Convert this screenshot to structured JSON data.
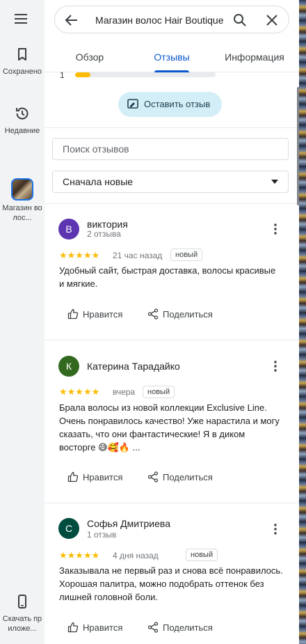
{
  "rail": {
    "items": [
      {
        "label": "Сохранено",
        "icon": "bookmark-icon"
      },
      {
        "label": "Недавние",
        "icon": "history-icon"
      },
      {
        "label": "Магазин волос...",
        "icon": "place-thumbnail"
      },
      {
        "label": "Скачать приложе...",
        "icon": "phone-icon"
      }
    ]
  },
  "search": {
    "value": "Магазин волос Hair Boutique"
  },
  "tabs": [
    {
      "label": "Обзор",
      "active": false
    },
    {
      "label": "Отзывы",
      "active": true
    },
    {
      "label": "Информация",
      "active": false
    }
  ],
  "rating_breakdown_partial": {
    "star_label": "1",
    "share": 0.11
  },
  "write_review_label": "Оставить отзыв",
  "review_search": {
    "placeholder": "Поиск отзывов"
  },
  "sort": {
    "selected": "Сначала новые"
  },
  "reviews": [
    {
      "initial": "В",
      "avatar_color": "#5e35b1",
      "author": "виктория",
      "meta": "2 отзыва",
      "rating": 5,
      "stars": "★★★★★",
      "date": "21 час назад",
      "badge": "новый",
      "text": "Удобный сайт, быстрая доставка, волосы красивые и мягкие.",
      "like": "Нравится",
      "share": "Поделиться"
    },
    {
      "initial": "К",
      "avatar_color": "#33691e",
      "author": "Катерина Тарадайко",
      "meta": "",
      "rating": 5,
      "stars": "★★★★★",
      "date": "вчера",
      "badge": "новый",
      "text": "Брала волосы из новой коллекции Exclusive Line. Очень понравилось качество! Уже нарастила и могу сказать, что они фантастические! Я в диком восторге 😅🥰🔥 ...",
      "like": "Нравится",
      "share": "Поделиться"
    },
    {
      "initial": "С",
      "avatar_color": "#004d40",
      "author": "Софья Дмитриева",
      "meta": "1 отзыв",
      "rating": 5,
      "stars": "★★★★★",
      "date": "4 дня назад",
      "badge": "новый",
      "text": "Заказывала не первый раз и снова всё понравилось. Хорошая палитра, можно подобрать оттенок без лишней головной боли.",
      "like": "Нравится",
      "share": "Поделиться"
    }
  ],
  "colors": {
    "accent": "#0b57d0",
    "star": "#fbbc04",
    "chip_bg": "#d3eef6"
  }
}
